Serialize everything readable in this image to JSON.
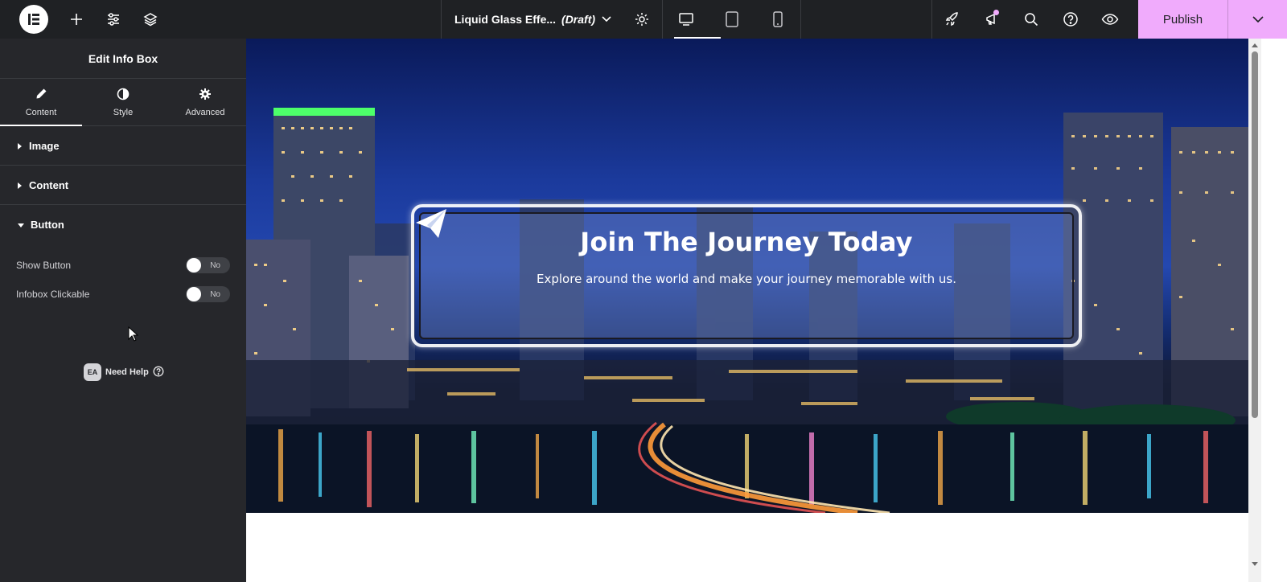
{
  "topbar": {
    "doc_title": "Liquid Glass Effe...",
    "doc_status": "(Draft)",
    "publish_label": "Publish"
  },
  "panel": {
    "title": "Edit Info Box",
    "tabs": [
      {
        "label": "Content",
        "icon": "pencil-icon"
      },
      {
        "label": "Style",
        "icon": "contrast-icon"
      },
      {
        "label": "Advanced",
        "icon": "gear-icon"
      }
    ],
    "sections": {
      "image": "Image",
      "content": "Content",
      "button": "Button"
    },
    "controls": {
      "show_button": {
        "label": "Show Button",
        "value": "No"
      },
      "infobox_clickable": {
        "label": "Infobox Clickable",
        "value": "No"
      }
    },
    "help": {
      "badge": "EA",
      "label": "Need Help"
    }
  },
  "canvas": {
    "infobox": {
      "icon": "paper-plane-icon",
      "title": "Join The Journey Today",
      "description": "Explore around the world and make your journey memorable with us."
    }
  },
  "colors": {
    "topbar_bg": "#1f2124",
    "panel_bg": "#26272b",
    "publish_accent": "#f0abfc"
  }
}
